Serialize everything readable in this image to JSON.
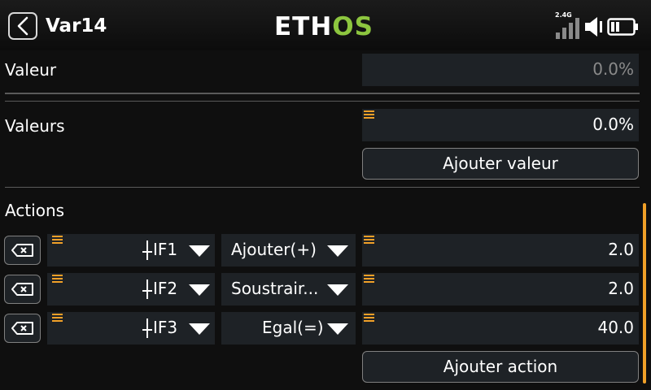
{
  "header": {
    "title": "Var14",
    "logo_part1": "ETH",
    "logo_part2": "OS",
    "rf_band": "2.4G"
  },
  "valeur": {
    "label": "Valeur",
    "value": "0.0%"
  },
  "valeurs": {
    "label": "Valeurs",
    "value": "0.0%",
    "add_label": "Ajouter valeur"
  },
  "actions": {
    "label": "Actions",
    "add_label": "Ajouter action",
    "rows": [
      {
        "condition": "IF1",
        "operation": "Ajouter(+)",
        "value": "2.0"
      },
      {
        "condition": "IF2",
        "operation": "Soustrair...",
        "value": "2.0"
      },
      {
        "condition": "IF3",
        "operation": "Egal(=)",
        "value": "40.0"
      }
    ]
  },
  "colors": {
    "accent": "#f0a028",
    "logo_green": "#8dc63f",
    "field_bg": "#1e2226",
    "background": "#0f0f0f"
  },
  "icons": {
    "back": "chevron-left-icon",
    "signal": "signal-bars-icon",
    "speaker": "speaker-icon",
    "battery": "battery-icon",
    "delete": "backspace-x-icon",
    "switch": "switch-icon",
    "dropdown": "triangle-down-icon",
    "drag": "drag-handle-icon"
  }
}
